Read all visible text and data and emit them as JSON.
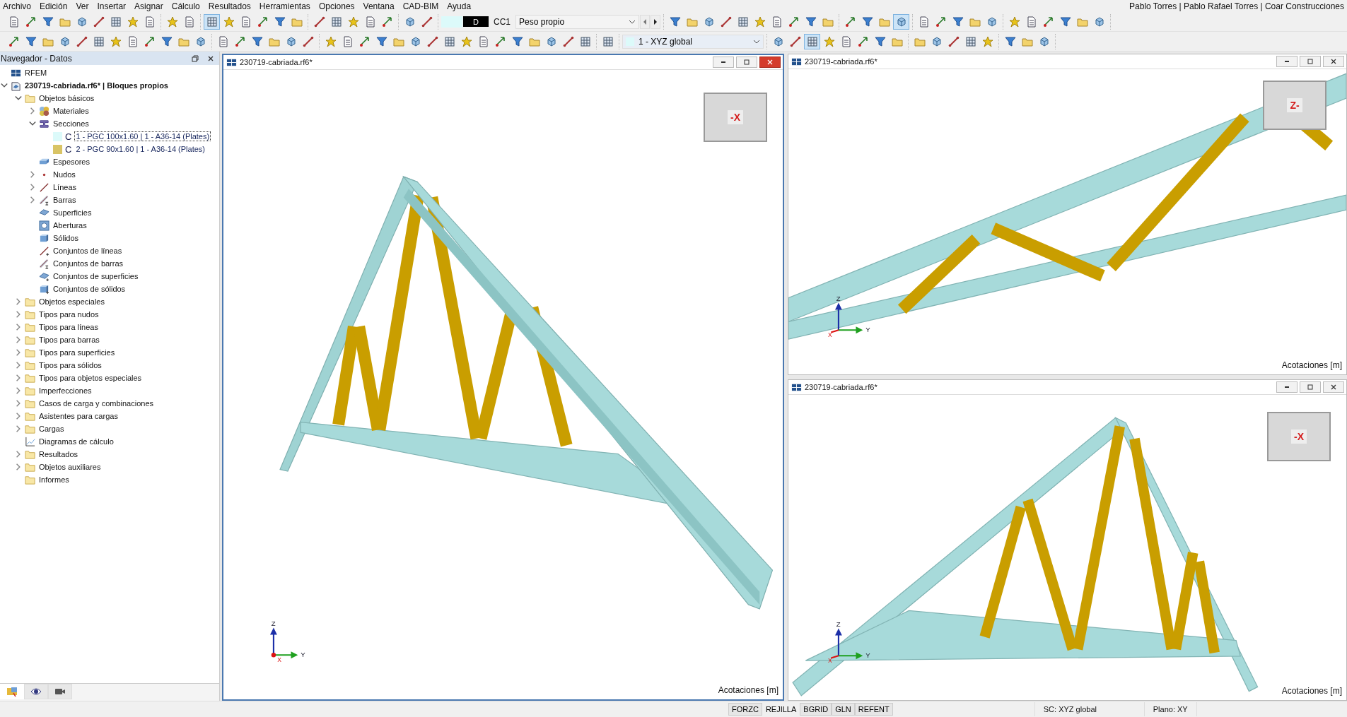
{
  "menu": [
    "Archivo",
    "Edición",
    "Ver",
    "Insertar",
    "Asignar",
    "Cálculo",
    "Resultados",
    "Herramientas",
    "Opciones",
    "Ventana",
    "CAD-BIM",
    "Ayuda"
  ],
  "user": "Pablo Torres | Pablo Rafael Torres | Coar Construcciones",
  "toolbars": [
    {
      "groups": [
        {
          "kind": "buttons",
          "pressed": [
            false,
            false,
            false,
            false,
            false,
            false,
            false,
            false,
            false
          ]
        },
        {
          "kind": "buttons",
          "pressed": [
            false,
            false
          ]
        },
        {
          "kind": "buttons",
          "pressed": [
            true,
            false,
            false,
            false,
            false,
            false
          ]
        },
        {
          "kind": "buttons",
          "pressed": [
            false,
            false,
            false,
            false,
            false
          ]
        },
        {
          "kind": "buttons",
          "pressed": [
            false,
            false
          ]
        },
        {
          "kind": "loadcase",
          "tag": "D",
          "code": "CC1",
          "name": "Peso propio"
        },
        {
          "kind": "buttons",
          "pressed": [
            false,
            false,
            false,
            false,
            false,
            false,
            false,
            false,
            false,
            false
          ]
        },
        {
          "kind": "buttons",
          "pressed": [
            false,
            false,
            false,
            true
          ]
        },
        {
          "kind": "buttons",
          "pressed": [
            false,
            false,
            false,
            false,
            false
          ]
        },
        {
          "kind": "buttons",
          "pressed": [
            false,
            false,
            false,
            false,
            false,
            false
          ]
        }
      ]
    },
    {
      "groups": [
        {
          "kind": "buttons",
          "pressed": [
            false,
            false,
            false,
            false,
            false,
            false,
            false,
            false,
            false,
            false,
            false,
            false
          ]
        },
        {
          "kind": "buttons",
          "pressed": [
            false,
            false,
            false,
            false,
            false,
            false
          ]
        },
        {
          "kind": "buttons",
          "pressed": [
            false,
            false,
            false,
            false,
            false,
            false,
            false,
            false,
            false,
            false,
            false,
            false,
            false,
            false,
            false,
            false
          ]
        },
        {
          "kind": "buttons",
          "pressed": [
            false
          ]
        },
        {
          "kind": "coordsys",
          "name": "1 - XYZ global"
        },
        {
          "kind": "buttons",
          "pressed": [
            false,
            false,
            true,
            false,
            false,
            false,
            false,
            false
          ]
        },
        {
          "kind": "buttons",
          "pressed": [
            false,
            false,
            false,
            false,
            false
          ]
        },
        {
          "kind": "buttons",
          "pressed": [
            false,
            false,
            false
          ]
        }
      ]
    }
  ],
  "navigator": {
    "title": "Navegador - Datos",
    "tree": [
      {
        "label": "RFEM",
        "kind": "rfem"
      },
      {
        "label": "230719-cabriada.rf6* | Bloques propios",
        "kind": "model",
        "expanded": true,
        "children": [
          {
            "label": "Objetos básicos",
            "kind": "folder",
            "expanded": true,
            "children": [
              {
                "label": "Materiales",
                "kind": "materials",
                "expanded": false
              },
              {
                "label": "Secciones",
                "kind": "section",
                "expanded": true,
                "children": [
                  {
                    "label": "1 - PGC 100x1.60 | 1 - A36-14 (Plates)",
                    "kind": "swatch",
                    "symbol": "C",
                    "color": "#dcfafa",
                    "selected": true
                  },
                  {
                    "label": "2 - PGC 90x1.60 | 1 - A36-14 (Plates)",
                    "kind": "swatch",
                    "symbol": "C",
                    "color": "#d9c465",
                    "selected": false
                  }
                ]
              },
              {
                "label": "Espesores",
                "kind": "thickness"
              },
              {
                "label": "Nudos",
                "kind": "node",
                "expanded": false
              },
              {
                "label": "Líneas",
                "kind": "line",
                "expanded": false
              },
              {
                "label": "Barras",
                "kind": "member",
                "expanded": false
              },
              {
                "label": "Superficies",
                "kind": "surface"
              },
              {
                "label": "Aberturas",
                "kind": "opening"
              },
              {
                "label": "Sólidos",
                "kind": "solid"
              },
              {
                "label": "Conjuntos de líneas",
                "kind": "lineset"
              },
              {
                "label": "Conjuntos de barras",
                "kind": "memberset"
              },
              {
                "label": "Conjuntos de superficies",
                "kind": "surfaceset"
              },
              {
                "label": "Conjuntos de sólidos",
                "kind": "solidset"
              }
            ]
          },
          {
            "label": "Objetos especiales",
            "kind": "folder",
            "expanded": false
          },
          {
            "label": "Tipos para nudos",
            "kind": "folder",
            "expanded": false
          },
          {
            "label": "Tipos para líneas",
            "kind": "folder",
            "expanded": false
          },
          {
            "label": "Tipos para barras",
            "kind": "folder",
            "expanded": false
          },
          {
            "label": "Tipos para superficies",
            "kind": "folder",
            "expanded": false
          },
          {
            "label": "Tipos para sólidos",
            "kind": "folder",
            "expanded": false
          },
          {
            "label": "Tipos para objetos especiales",
            "kind": "folder",
            "expanded": false
          },
          {
            "label": "Imperfecciones",
            "kind": "folder",
            "expanded": false
          },
          {
            "label": "Casos de carga y combinaciones",
            "kind": "folder",
            "expanded": false
          },
          {
            "label": "Asistentes para cargas",
            "kind": "folder",
            "expanded": false
          },
          {
            "label": "Cargas",
            "kind": "folder",
            "expanded": false
          },
          {
            "label": "Diagramas de cálculo",
            "kind": "diagram"
          },
          {
            "label": "Resultados",
            "kind": "folder",
            "expanded": false
          },
          {
            "label": "Objetos auxiliares",
            "kind": "folder",
            "expanded": false
          },
          {
            "label": "Informes",
            "kind": "folder"
          }
        ]
      }
    ],
    "tabs": [
      {
        "kind": "data",
        "selected": true
      },
      {
        "kind": "eye",
        "selected": false
      },
      {
        "kind": "camera",
        "selected": false
      }
    ]
  },
  "views": [
    {
      "kind": "elevation",
      "title": "230719-cabriada.rf6*",
      "active": true,
      "cube_label": "-X",
      "axes": [
        "Z",
        "X",
        "Y"
      ],
      "footer": "Acotaciones [m]"
    },
    {
      "kind": "perspective-top",
      "title": "230719-cabriada.rf6*",
      "active": false,
      "cube_label": "Z-",
      "axes": [
        "Z",
        "X",
        "Y"
      ],
      "footer": "Acotaciones [m]"
    },
    {
      "kind": "perspective-bottom",
      "title": "230719-cabriada.rf6*",
      "active": false,
      "cube_label": "-X",
      "axes": [
        "Z",
        "X",
        "Y"
      ],
      "footer": "Acotaciones [m]"
    }
  ],
  "status_bar": {
    "toggles": [
      {
        "label": "FORZC",
        "selected": true
      },
      {
        "label": "REJILLA",
        "selected": false
      },
      {
        "label": "BGRID",
        "selected": true
      },
      {
        "label": "GLN",
        "selected": true
      },
      {
        "label": "REFENT",
        "selected": true
      }
    ],
    "system": "SC: XYZ global",
    "plane": "Plano: XY"
  }
}
